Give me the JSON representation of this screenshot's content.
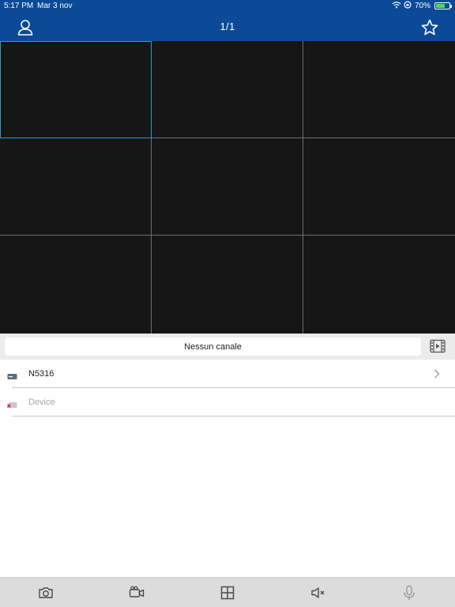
{
  "status": {
    "time": "5:17 PM",
    "date": "Mar 3 nov",
    "battery_percent_text": "70%",
    "battery_level": 0.7,
    "icons": [
      "wifi-icon",
      "orientation-lock-icon",
      "battery-charging-icon"
    ]
  },
  "nav": {
    "title": "1/1",
    "left_icon": "user-icon",
    "right_icon": "star-icon"
  },
  "grid": {
    "rows": 3,
    "cols": 3,
    "selected_cell": 0
  },
  "channel": {
    "label": "Nessun canale",
    "action_icon": "film-icon"
  },
  "devices": [
    {
      "name": "N5316",
      "status": "online",
      "icon": "dvr-icon",
      "has_chevron": true
    },
    {
      "name": "Device",
      "status": "offline",
      "icon": "dvr-offline-icon",
      "has_chevron": false
    }
  ],
  "toolbar": {
    "items": [
      "camera-icon",
      "video-record-icon",
      "grid-layout-icon",
      "mute-icon",
      "microphone-icon"
    ]
  },
  "colors": {
    "header_bg": "#0b4a97",
    "grid_bg": "#161616",
    "grid_line": "#6e6e6e",
    "selection": "#2f9bd8",
    "toolbar_bg": "#dcdcdc"
  }
}
